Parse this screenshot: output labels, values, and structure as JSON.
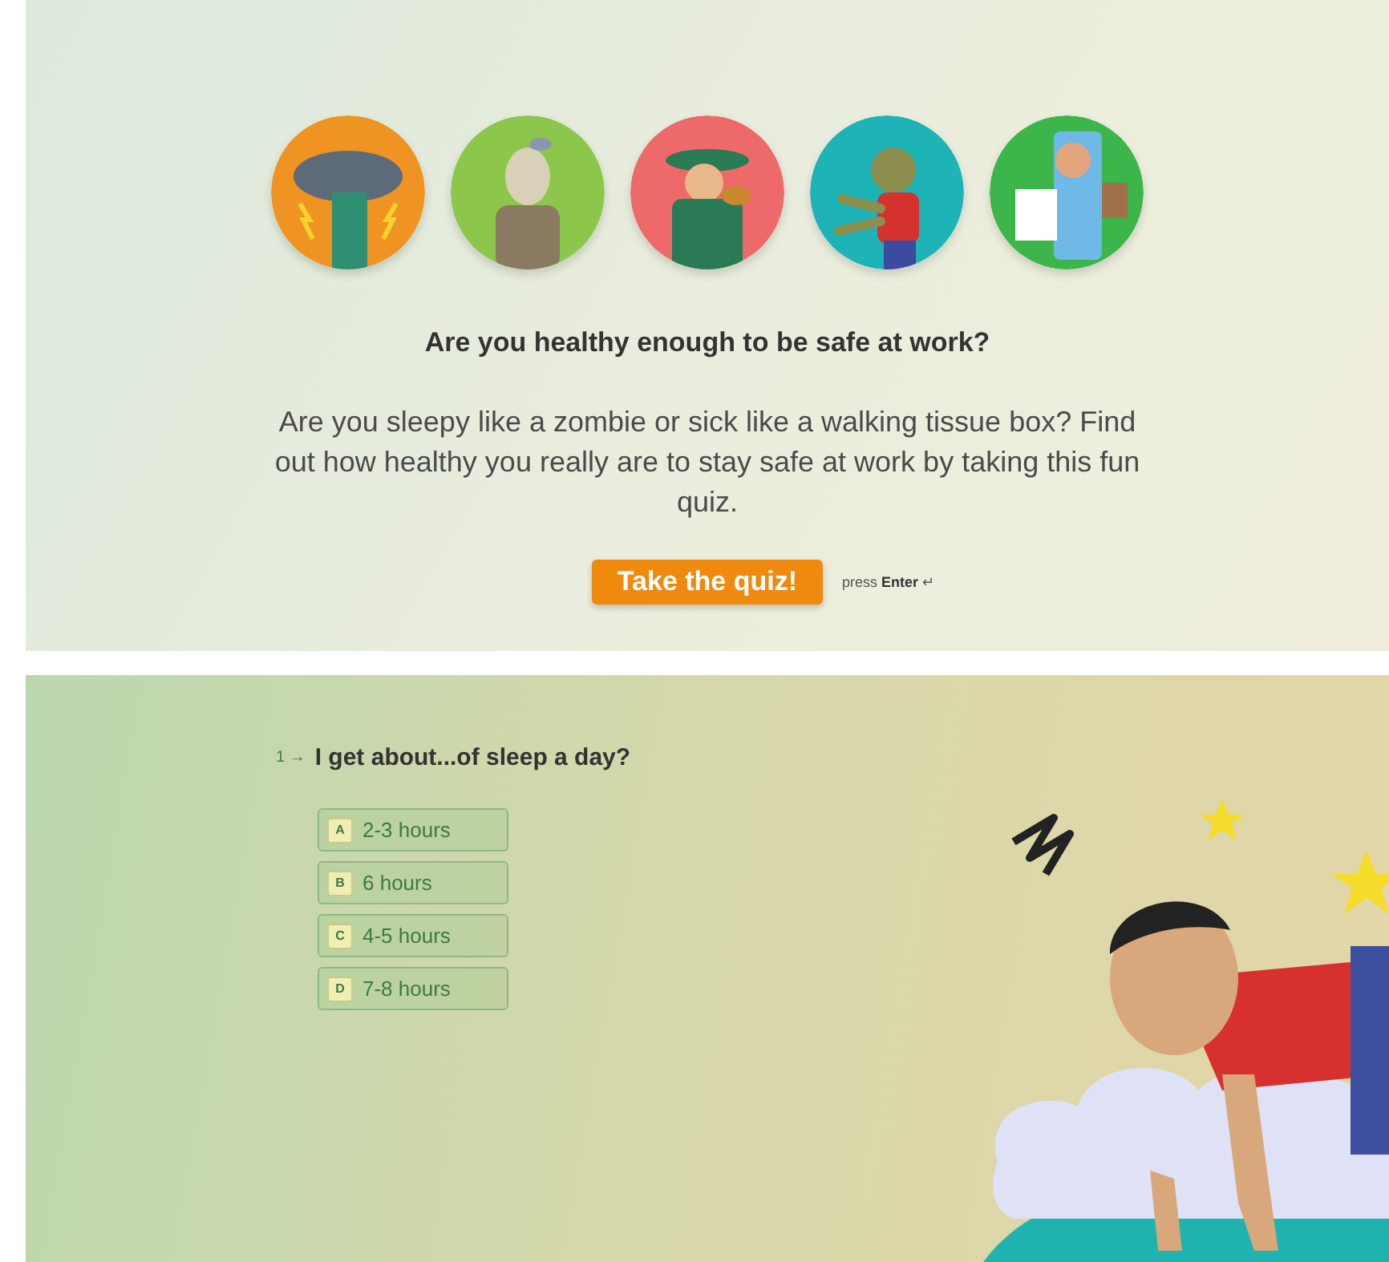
{
  "intro": {
    "title": "Are you healthy enough to be safe at work?",
    "description": "Are you sleepy like a zombie or sick like a walking tissue box? Find out how healthy you really are to stay safe at work by taking this fun quiz.",
    "button": "Take the quiz!",
    "hint_prefix": "press",
    "hint_key": "Enter",
    "hint_icon": "↵"
  },
  "question": {
    "number": "1",
    "arrow": "→",
    "text": "I get about...of sleep a day?",
    "options": [
      {
        "key": "A",
        "label": "2-3 hours",
        "selected": false
      },
      {
        "key": "B",
        "label": "6 hours",
        "selected": false
      },
      {
        "key": "C",
        "label": "4-5 hours",
        "selected": false
      },
      {
        "key": "D",
        "label": "7-8 hours",
        "selected": false
      }
    ]
  }
}
